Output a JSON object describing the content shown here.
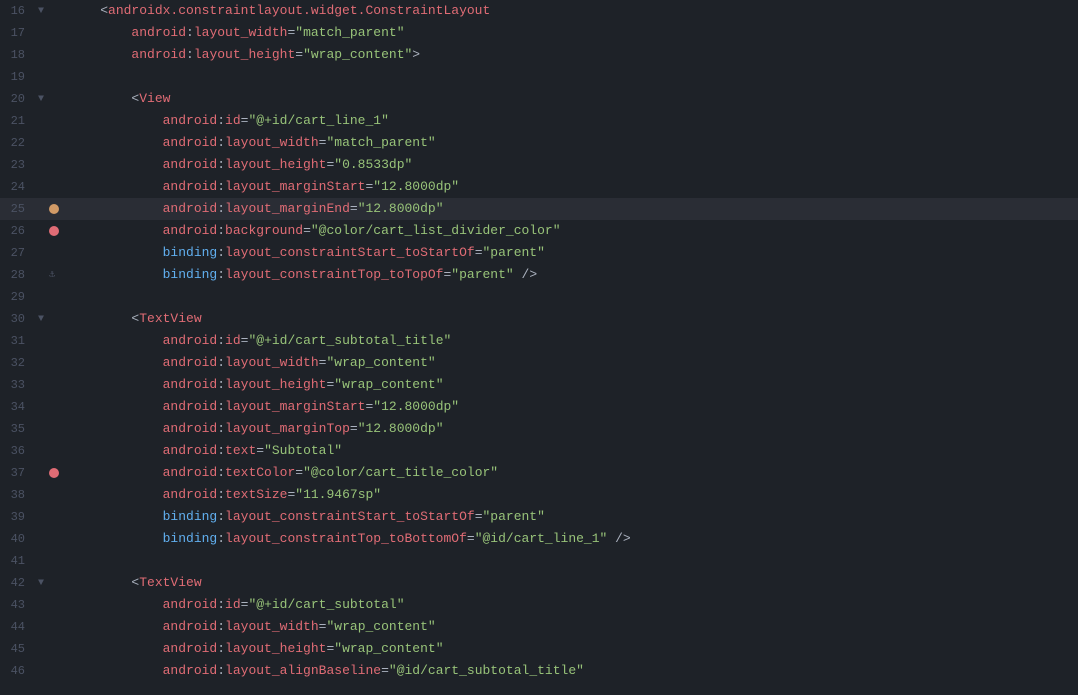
{
  "editor": {
    "lines": [
      {
        "num": 16,
        "fold": "▼",
        "breakpoint": false,
        "bookmark": false,
        "anchor": false,
        "indent": 0,
        "tokens": [
          {
            "type": "text-content",
            "text": "    <"
          },
          {
            "type": "tag",
            "text": "androidx.constraintlayout.widget.ConstraintLayout"
          }
        ]
      },
      {
        "num": 17,
        "fold": "",
        "breakpoint": false,
        "bookmark": false,
        "anchor": false,
        "indent": 0,
        "tokens": [
          {
            "type": "text-content",
            "text": "        "
          },
          {
            "type": "attr-name",
            "text": "android"
          },
          {
            "type": "text-content",
            "text": ":"
          },
          {
            "type": "attr-name",
            "text": "layout_width"
          },
          {
            "type": "equals",
            "text": "="
          },
          {
            "type": "attr-value",
            "text": "\"match_parent\""
          }
        ]
      },
      {
        "num": 18,
        "fold": "",
        "breakpoint": false,
        "bookmark": false,
        "anchor": false,
        "indent": 0,
        "tokens": [
          {
            "type": "text-content",
            "text": "        "
          },
          {
            "type": "attr-name",
            "text": "android"
          },
          {
            "type": "text-content",
            "text": ":"
          },
          {
            "type": "attr-name",
            "text": "layout_height"
          },
          {
            "type": "equals",
            "text": "="
          },
          {
            "type": "attr-value",
            "text": "\"wrap_content\""
          },
          {
            "type": "text-content",
            "text": ">"
          }
        ]
      },
      {
        "num": 19,
        "fold": "",
        "breakpoint": false,
        "bookmark": false,
        "anchor": false,
        "indent": 0,
        "tokens": []
      },
      {
        "num": 20,
        "fold": "▼",
        "breakpoint": false,
        "bookmark": false,
        "anchor": false,
        "indent": 0,
        "tokens": [
          {
            "type": "text-content",
            "text": "        <"
          },
          {
            "type": "tag",
            "text": "View"
          }
        ]
      },
      {
        "num": 21,
        "fold": "",
        "breakpoint": false,
        "bookmark": false,
        "anchor": false,
        "indent": 0,
        "tokens": [
          {
            "type": "text-content",
            "text": "            "
          },
          {
            "type": "attr-name",
            "text": "android"
          },
          {
            "type": "text-content",
            "text": ":"
          },
          {
            "type": "attr-name",
            "text": "id"
          },
          {
            "type": "equals",
            "text": "="
          },
          {
            "type": "attr-value",
            "text": "\"@+id/cart_line_1\""
          }
        ]
      },
      {
        "num": 22,
        "fold": "",
        "breakpoint": false,
        "bookmark": false,
        "anchor": false,
        "indent": 0,
        "tokens": [
          {
            "type": "text-content",
            "text": "            "
          },
          {
            "type": "attr-name",
            "text": "android"
          },
          {
            "type": "text-content",
            "text": ":"
          },
          {
            "type": "attr-name",
            "text": "layout_width"
          },
          {
            "type": "equals",
            "text": "="
          },
          {
            "type": "attr-value",
            "text": "\"match_parent\""
          }
        ]
      },
      {
        "num": 23,
        "fold": "",
        "breakpoint": false,
        "bookmark": false,
        "anchor": false,
        "indent": 0,
        "tokens": [
          {
            "type": "text-content",
            "text": "            "
          },
          {
            "type": "attr-name",
            "text": "android"
          },
          {
            "type": "text-content",
            "text": ":"
          },
          {
            "type": "attr-name",
            "text": "layout_height"
          },
          {
            "type": "equals",
            "text": "="
          },
          {
            "type": "attr-value",
            "text": "\"0.8533dp\""
          }
        ]
      },
      {
        "num": 24,
        "fold": "",
        "breakpoint": false,
        "bookmark": false,
        "anchor": false,
        "indent": 0,
        "tokens": [
          {
            "type": "text-content",
            "text": "            "
          },
          {
            "type": "attr-name",
            "text": "android"
          },
          {
            "type": "text-content",
            "text": ":"
          },
          {
            "type": "attr-name",
            "text": "layout_marginStart"
          },
          {
            "type": "equals",
            "text": "="
          },
          {
            "type": "attr-value",
            "text": "\"12.8000dp\""
          }
        ]
      },
      {
        "num": 25,
        "fold": "",
        "breakpoint": false,
        "bookmark": true,
        "anchor": false,
        "indent": 0,
        "highlighted": true,
        "tokens": [
          {
            "type": "text-content",
            "text": "            "
          },
          {
            "type": "attr-name",
            "text": "android"
          },
          {
            "type": "text-content",
            "text": ":"
          },
          {
            "type": "attr-name",
            "text": "layout_marginEnd"
          },
          {
            "type": "equals",
            "text": "="
          },
          {
            "type": "attr-value",
            "text": "\"12.8000dp\""
          }
        ]
      },
      {
        "num": 26,
        "fold": "",
        "breakpoint": true,
        "bookmark": false,
        "anchor": false,
        "indent": 0,
        "tokens": [
          {
            "type": "text-content",
            "text": "            "
          },
          {
            "type": "attr-name",
            "text": "android"
          },
          {
            "type": "text-content",
            "text": ":"
          },
          {
            "type": "attr-name",
            "text": "background"
          },
          {
            "type": "equals",
            "text": "="
          },
          {
            "type": "attr-value",
            "text": "\"@color/cart_list_divider_color\""
          }
        ]
      },
      {
        "num": 27,
        "fold": "",
        "breakpoint": false,
        "bookmark": false,
        "anchor": false,
        "indent": 0,
        "tokens": [
          {
            "type": "text-content",
            "text": "            "
          },
          {
            "type": "binding-name",
            "text": "binding"
          },
          {
            "type": "text-content",
            "text": ":"
          },
          {
            "type": "attr-name",
            "text": "layout_constraintStart_toStartOf"
          },
          {
            "type": "equals",
            "text": "="
          },
          {
            "type": "attr-value",
            "text": "\"parent\""
          }
        ]
      },
      {
        "num": 28,
        "fold": "",
        "breakpoint": false,
        "bookmark": false,
        "anchor": true,
        "indent": 0,
        "tokens": [
          {
            "type": "text-content",
            "text": "            "
          },
          {
            "type": "binding-name",
            "text": "binding"
          },
          {
            "type": "text-content",
            "text": ":"
          },
          {
            "type": "attr-name",
            "text": "layout_constraintTop_toTopOf"
          },
          {
            "type": "equals",
            "text": "="
          },
          {
            "type": "attr-value",
            "text": "\"parent\""
          },
          {
            "type": "text-content",
            "text": " />"
          }
        ]
      },
      {
        "num": 29,
        "fold": "",
        "breakpoint": false,
        "bookmark": false,
        "anchor": false,
        "indent": 0,
        "tokens": []
      },
      {
        "num": 30,
        "fold": "▼",
        "breakpoint": false,
        "bookmark": false,
        "anchor": false,
        "indent": 0,
        "tokens": [
          {
            "type": "text-content",
            "text": "        <"
          },
          {
            "type": "tag",
            "text": "TextView"
          }
        ]
      },
      {
        "num": 31,
        "fold": "",
        "breakpoint": false,
        "bookmark": false,
        "anchor": false,
        "indent": 0,
        "tokens": [
          {
            "type": "text-content",
            "text": "            "
          },
          {
            "type": "attr-name",
            "text": "android"
          },
          {
            "type": "text-content",
            "text": ":"
          },
          {
            "type": "attr-name",
            "text": "id"
          },
          {
            "type": "equals",
            "text": "="
          },
          {
            "type": "attr-value",
            "text": "\"@+id/cart_subtotal_title\""
          }
        ]
      },
      {
        "num": 32,
        "fold": "",
        "breakpoint": false,
        "bookmark": false,
        "anchor": false,
        "indent": 0,
        "tokens": [
          {
            "type": "text-content",
            "text": "            "
          },
          {
            "type": "attr-name",
            "text": "android"
          },
          {
            "type": "text-content",
            "text": ":"
          },
          {
            "type": "attr-name",
            "text": "layout_width"
          },
          {
            "type": "equals",
            "text": "="
          },
          {
            "type": "attr-value",
            "text": "\"wrap_content\""
          }
        ]
      },
      {
        "num": 33,
        "fold": "",
        "breakpoint": false,
        "bookmark": false,
        "anchor": false,
        "indent": 0,
        "tokens": [
          {
            "type": "text-content",
            "text": "            "
          },
          {
            "type": "attr-name",
            "text": "android"
          },
          {
            "type": "text-content",
            "text": ":"
          },
          {
            "type": "attr-name",
            "text": "layout_height"
          },
          {
            "type": "equals",
            "text": "="
          },
          {
            "type": "attr-value",
            "text": "\"wrap_content\""
          }
        ]
      },
      {
        "num": 34,
        "fold": "",
        "breakpoint": false,
        "bookmark": false,
        "anchor": false,
        "indent": 0,
        "tokens": [
          {
            "type": "text-content",
            "text": "            "
          },
          {
            "type": "attr-name",
            "text": "android"
          },
          {
            "type": "text-content",
            "text": ":"
          },
          {
            "type": "attr-name",
            "text": "layout_marginStart"
          },
          {
            "type": "equals",
            "text": "="
          },
          {
            "type": "attr-value",
            "text": "\"12.8000dp\""
          }
        ]
      },
      {
        "num": 35,
        "fold": "",
        "breakpoint": false,
        "bookmark": false,
        "anchor": false,
        "indent": 0,
        "tokens": [
          {
            "type": "text-content",
            "text": "            "
          },
          {
            "type": "attr-name",
            "text": "android"
          },
          {
            "type": "text-content",
            "text": ":"
          },
          {
            "type": "attr-name",
            "text": "layout_marginTop"
          },
          {
            "type": "equals",
            "text": "="
          },
          {
            "type": "attr-value",
            "text": "\"12.8000dp\""
          }
        ]
      },
      {
        "num": 36,
        "fold": "",
        "breakpoint": false,
        "bookmark": false,
        "anchor": false,
        "indent": 0,
        "tokens": [
          {
            "type": "text-content",
            "text": "            "
          },
          {
            "type": "attr-name",
            "text": "android"
          },
          {
            "type": "text-content",
            "text": ":"
          },
          {
            "type": "attr-name",
            "text": "text"
          },
          {
            "type": "equals",
            "text": "="
          },
          {
            "type": "attr-value",
            "text": "\"Subtotal\""
          }
        ]
      },
      {
        "num": 37,
        "fold": "",
        "breakpoint": true,
        "bookmark": false,
        "anchor": false,
        "indent": 0,
        "tokens": [
          {
            "type": "text-content",
            "text": "            "
          },
          {
            "type": "attr-name",
            "text": "android"
          },
          {
            "type": "text-content",
            "text": ":"
          },
          {
            "type": "attr-name",
            "text": "textColor"
          },
          {
            "type": "equals",
            "text": "="
          },
          {
            "type": "attr-value",
            "text": "\"@color/cart_title_color\""
          }
        ]
      },
      {
        "num": 38,
        "fold": "",
        "breakpoint": false,
        "bookmark": false,
        "anchor": false,
        "indent": 0,
        "tokens": [
          {
            "type": "text-content",
            "text": "            "
          },
          {
            "type": "attr-name",
            "text": "android"
          },
          {
            "type": "text-content",
            "text": ":"
          },
          {
            "type": "attr-name",
            "text": "textSize"
          },
          {
            "type": "equals",
            "text": "="
          },
          {
            "type": "attr-value",
            "text": "\"11.9467sp\""
          }
        ]
      },
      {
        "num": 39,
        "fold": "",
        "breakpoint": false,
        "bookmark": false,
        "anchor": false,
        "indent": 0,
        "tokens": [
          {
            "type": "text-content",
            "text": "            "
          },
          {
            "type": "binding-name",
            "text": "binding"
          },
          {
            "type": "text-content",
            "text": ":"
          },
          {
            "type": "attr-name",
            "text": "layout_constraintStart_toStartOf"
          },
          {
            "type": "equals",
            "text": "="
          },
          {
            "type": "attr-value",
            "text": "\"parent\""
          }
        ]
      },
      {
        "num": 40,
        "fold": "",
        "breakpoint": false,
        "bookmark": false,
        "anchor": false,
        "indent": 0,
        "tokens": [
          {
            "type": "text-content",
            "text": "            "
          },
          {
            "type": "binding-name",
            "text": "binding"
          },
          {
            "type": "text-content",
            "text": ":"
          },
          {
            "type": "attr-name",
            "text": "layout_constraintTop_toBottomOf"
          },
          {
            "type": "equals",
            "text": "="
          },
          {
            "type": "attr-value",
            "text": "\"@id/cart_line_1\""
          },
          {
            "type": "text-content",
            "text": " />"
          }
        ]
      },
      {
        "num": 41,
        "fold": "",
        "breakpoint": false,
        "bookmark": false,
        "anchor": false,
        "indent": 0,
        "tokens": []
      },
      {
        "num": 42,
        "fold": "▼",
        "breakpoint": false,
        "bookmark": false,
        "anchor": false,
        "indent": 0,
        "tokens": [
          {
            "type": "text-content",
            "text": "        <"
          },
          {
            "type": "tag",
            "text": "TextView"
          }
        ]
      },
      {
        "num": 43,
        "fold": "",
        "breakpoint": false,
        "bookmark": false,
        "anchor": false,
        "indent": 0,
        "tokens": [
          {
            "type": "text-content",
            "text": "            "
          },
          {
            "type": "attr-name",
            "text": "android"
          },
          {
            "type": "text-content",
            "text": ":"
          },
          {
            "type": "attr-name",
            "text": "id"
          },
          {
            "type": "equals",
            "text": "="
          },
          {
            "type": "attr-value",
            "text": "\"@+id/cart_subtotal\""
          }
        ]
      },
      {
        "num": 44,
        "fold": "",
        "breakpoint": false,
        "bookmark": false,
        "anchor": false,
        "indent": 0,
        "tokens": [
          {
            "type": "text-content",
            "text": "            "
          },
          {
            "type": "attr-name",
            "text": "android"
          },
          {
            "type": "text-content",
            "text": ":"
          },
          {
            "type": "attr-name",
            "text": "layout_width"
          },
          {
            "type": "equals",
            "text": "="
          },
          {
            "type": "attr-value",
            "text": "\"wrap_content\""
          }
        ]
      },
      {
        "num": 45,
        "fold": "",
        "breakpoint": false,
        "bookmark": false,
        "anchor": false,
        "indent": 0,
        "tokens": [
          {
            "type": "text-content",
            "text": "            "
          },
          {
            "type": "attr-name",
            "text": "android"
          },
          {
            "type": "text-content",
            "text": ":"
          },
          {
            "type": "attr-name",
            "text": "layout_height"
          },
          {
            "type": "equals",
            "text": "="
          },
          {
            "type": "attr-value",
            "text": "\"wrap_content\""
          }
        ]
      },
      {
        "num": 46,
        "fold": "",
        "breakpoint": false,
        "bookmark": false,
        "anchor": false,
        "indent": 0,
        "tokens": [
          {
            "type": "text-content",
            "text": "            "
          },
          {
            "type": "attr-name",
            "text": "android"
          },
          {
            "type": "text-content",
            "text": ":"
          },
          {
            "type": "attr-name",
            "text": "layout_alignBaseline"
          },
          {
            "type": "equals",
            "text": "="
          },
          {
            "type": "attr-value",
            "text": "\"@id/cart_subtotal_title\""
          }
        ]
      }
    ]
  }
}
